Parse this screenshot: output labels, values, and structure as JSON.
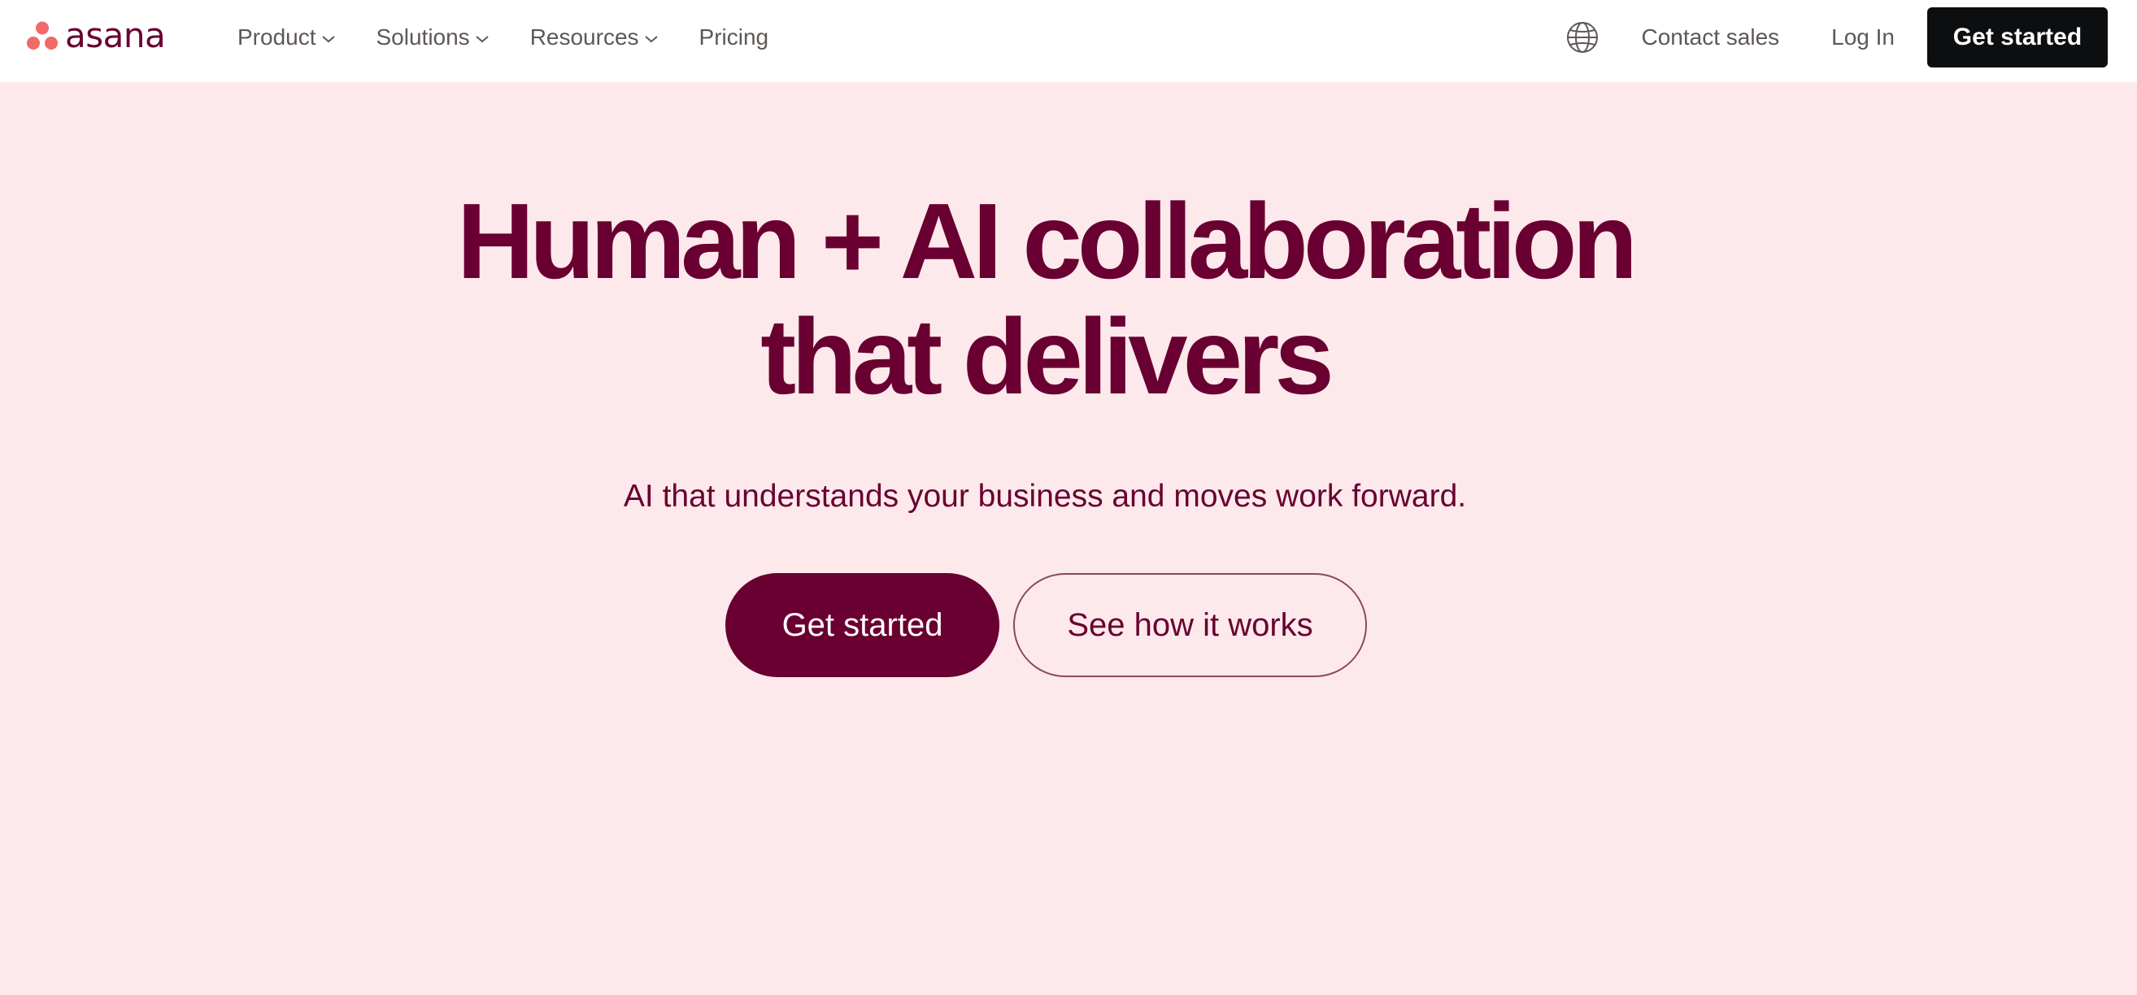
{
  "brand": {
    "name": "asana",
    "logo_color": "#f06a6a",
    "text_color": "#690031"
  },
  "nav": {
    "items": [
      {
        "label": "Product",
        "has_dropdown": true
      },
      {
        "label": "Solutions",
        "has_dropdown": true
      },
      {
        "label": "Resources",
        "has_dropdown": true
      },
      {
        "label": "Pricing",
        "has_dropdown": false
      }
    ],
    "language_icon": "globe-icon",
    "contact_sales": "Contact sales",
    "login": "Log In",
    "cta": "Get started"
  },
  "hero": {
    "title_line1": "Human + AI collaboration",
    "title_line2": "that delivers",
    "subtitle": "AI that understands your business and moves work forward.",
    "primary_button": "Get started",
    "secondary_button": "See how it works",
    "background": "#fde9eb",
    "accent": "#690031"
  }
}
